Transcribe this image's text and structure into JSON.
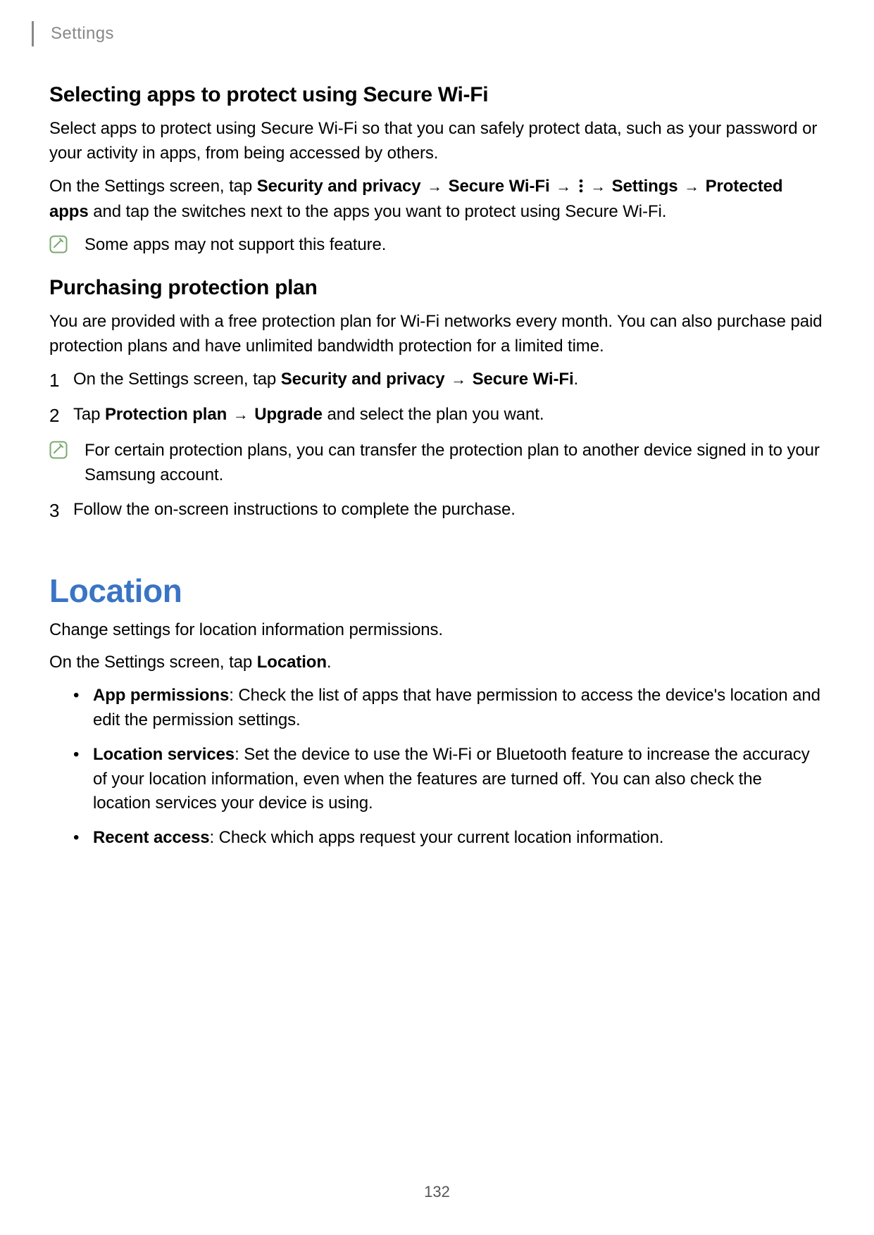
{
  "header": {
    "section": "Settings"
  },
  "sec1": {
    "heading": "Selecting apps to protect using Secure Wi-Fi",
    "p1": "Select apps to protect using Secure Wi-Fi so that you can safely protect data, such as your password or your activity in apps, from being accessed by others.",
    "p2_prefix": "On the Settings screen, tap ",
    "p2_b1": "Security and privacy",
    "p2_b2": "Secure Wi-Fi",
    "p2_b3": "Settings",
    "p2_b4": "Protected apps",
    "p2_suffix": " and tap the switches next to the apps you want to protect using Secure Wi-Fi.",
    "note1": "Some apps may not support this feature."
  },
  "sec2": {
    "heading": "Purchasing protection plan",
    "p1": "You are provided with a free protection plan for Wi-Fi networks every month. You can also purchase paid protection plans and have unlimited bandwidth protection for a limited time.",
    "step1_prefix": "On the Settings screen, tap ",
    "step1_b1": "Security and privacy",
    "step1_b2": "Secure Wi-Fi",
    "step1_suffix": ".",
    "step2_prefix": "Tap ",
    "step2_b1": "Protection plan",
    "step2_b2": "Upgrade",
    "step2_suffix": " and select the plan you want.",
    "step2_note": "For certain protection plans, you can transfer the protection plan to another device signed in to your Samsung account.",
    "step3": "Follow the on-screen instructions to complete the purchase."
  },
  "sec3": {
    "heading": "Location",
    "p1": "Change settings for location information permissions.",
    "p2_prefix": "On the Settings screen, tap ",
    "p2_b1": "Location",
    "p2_suffix": ".",
    "bullets": {
      "b1_label": "App permissions",
      "b1_text": ": Check the list of apps that have permission to access the device's location and edit the permission settings.",
      "b2_label": "Location services",
      "b2_text": ": Set the device to use the Wi-Fi or Bluetooth feature to increase the accuracy of your location information, even when the features are turned off. You can also check the location services your device is using.",
      "b3_label": "Recent access",
      "b3_text": ": Check which apps request your current location information."
    }
  },
  "arrow": "→",
  "page_number": "132"
}
